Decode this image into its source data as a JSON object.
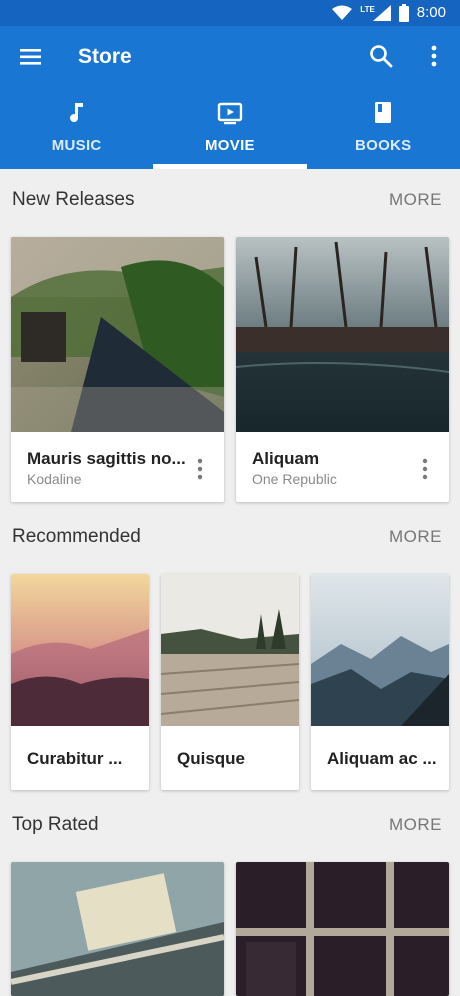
{
  "status_bar": {
    "time": "8:00",
    "network": "LTE",
    "icons": [
      "wifi-icon",
      "signal-icon",
      "battery-icon"
    ]
  },
  "app_bar": {
    "title": "Store",
    "icons": [
      "menu-icon",
      "search-icon",
      "more-vert-icon"
    ],
    "color": "#1976d2",
    "status_color": "#1565c0"
  },
  "tabs": [
    {
      "label": "MUSIC",
      "icon": "music-note-icon",
      "active": false
    },
    {
      "label": "MOVIE",
      "icon": "tv-play-icon",
      "active": true
    },
    {
      "label": "BOOKS",
      "icon": "book-icon",
      "active": false
    }
  ],
  "sections": {
    "new_releases": {
      "title": "New Releases",
      "more_label": "MORE",
      "items": [
        {
          "title": "Mauris sagittis no...",
          "subtitle": "Kodaline",
          "image": "bench-photo"
        },
        {
          "title": "Aliquam",
          "subtitle": "One Republic",
          "image": "dock-photo"
        }
      ]
    },
    "recommended": {
      "title": "Recommended",
      "more_label": "MORE",
      "items": [
        {
          "title": "Curabitur ...",
          "image": "misty-hills-photo"
        },
        {
          "title": "Quisque",
          "image": "wooden-pier-photo"
        },
        {
          "title": "Aliquam ac ...",
          "image": "mountains-photo"
        }
      ]
    },
    "top_rated": {
      "title": "Top Rated",
      "more_label": "MORE",
      "items": [
        {
          "image": "typewriter-photo"
        },
        {
          "image": "window-photo"
        }
      ]
    }
  }
}
